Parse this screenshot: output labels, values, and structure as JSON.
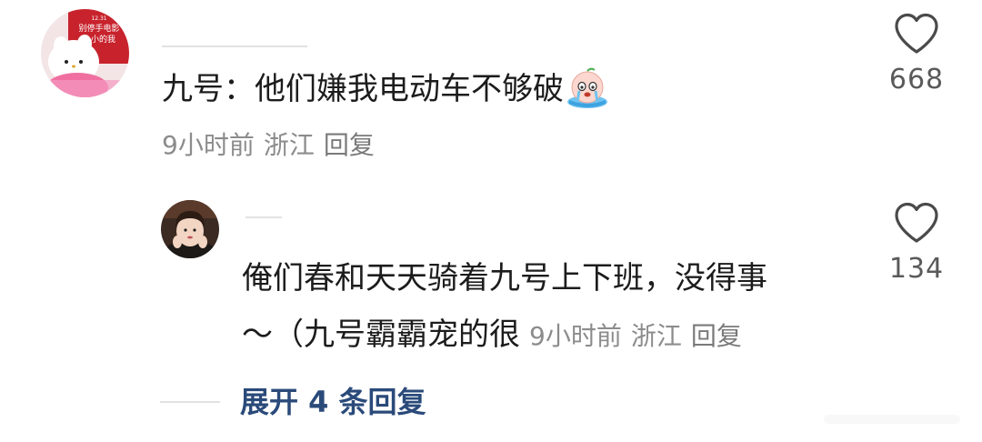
{
  "comments": [
    {
      "text": "九号：他们嫌我电动车不够破",
      "emoji": "crying-face-emoji",
      "meta": {
        "time": "9小时前",
        "location": "浙江",
        "reply": "回复"
      },
      "likes": "668",
      "avatar_text": "12.31\n别停手·电影\n小小的我"
    },
    {
      "line1": "俺们春和天天骑着九号上下班，没得事",
      "line2": "～（九号霸霸宠的很",
      "meta": {
        "time": "9小时前",
        "location": "浙江",
        "reply": "回复"
      },
      "likes": "134"
    }
  ],
  "expand": {
    "label": "展开 4 条回复"
  },
  "colors": {
    "text": "#1c1c1c",
    "meta": "#8c8c8c",
    "link": "#2a4a7a",
    "like_count": "#5a5a5a"
  },
  "icons": [
    "heart-outline-icon"
  ]
}
